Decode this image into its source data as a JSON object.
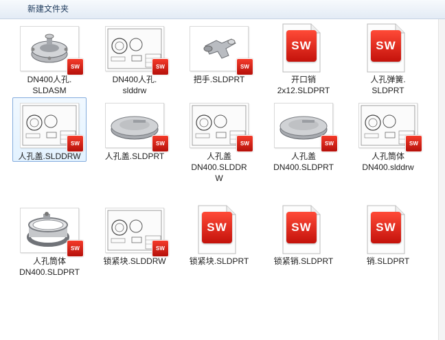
{
  "toolbar": {
    "new_folder_label": "新建文件夹"
  },
  "badge_text": "SW",
  "colors": {
    "badge": "#e0231a",
    "selection": "#cce8ff",
    "toolbar": "#e3ebf5"
  },
  "files": [
    {
      "name": "DN400人孔.SLDASM",
      "line1": "DN400人孔.",
      "line2": "SLDASM",
      "line3": "",
      "icon": "assembly-thumbnail-icon"
    },
    {
      "name": "DN400人孔.slddrw",
      "line1": "DN400人孔.",
      "line2": "slddrw",
      "line3": "",
      "icon": "drawing-thumbnail-icon"
    },
    {
      "name": "把手.SLDPRT",
      "line1": "把手.SLDPRT",
      "line2": "",
      "line3": "",
      "icon": "handle-part-thumbnail-icon"
    },
    {
      "name": "开口销2x12.SLDPRT",
      "line1": "开口销",
      "line2": "2x12.SLDPRT",
      "line3": "",
      "icon": "solidworks-document-icon"
    },
    {
      "name": "人孔弹簧.SLDPRT",
      "line1": "人孔弹簧.",
      "line2": "SLDPRT",
      "line3": "",
      "icon": "solidworks-document-icon"
    },
    {
      "name": "人孔盖.SLDDRW",
      "line1": "人孔盖.SLDDRW",
      "line2": "",
      "line3": "",
      "icon": "drawing-thumbnail-icon"
    },
    {
      "name": "人孔盖.SLDPRT",
      "line1": "人孔盖.SLDPRT",
      "line2": "",
      "line3": "",
      "icon": "cover-part-thumbnail-icon"
    },
    {
      "name": "人孔盖DN400.SLDDRW",
      "line1": "人孔盖",
      "line2": "DN400.SLDDR",
      "line3": "W",
      "icon": "drawing-thumbnail-icon"
    },
    {
      "name": "人孔盖DN400.SLDPRT",
      "line1": "人孔盖",
      "line2": "DN400.SLDPRT",
      "line3": "",
      "icon": "cover-part-thumbnail-icon"
    },
    {
      "name": "人孔筒体DN400.slddrw",
      "line1": "人孔筒体",
      "line2": "DN400.slddrw",
      "line3": "",
      "icon": "drawing-thumbnail-icon"
    },
    {
      "name": "人孔筒体DN400.SLDPRT",
      "line1": "人孔筒体",
      "line2": "DN400.SLDPRT",
      "line3": "",
      "icon": "cylinder-part-thumbnail-icon"
    },
    {
      "name": "锁紧块.SLDDRW",
      "line1": "锁紧块.SLDDRW",
      "line2": "",
      "line3": "",
      "icon": "drawing-thumbnail-icon"
    },
    {
      "name": "锁紧块.SLDPRT",
      "line1": "锁紧块.SLDPRT",
      "line2": "",
      "line3": "",
      "icon": "solidworks-document-icon"
    },
    {
      "name": "锁紧销.SLDPRT",
      "line1": "锁紧销.SLDPRT",
      "line2": "",
      "line3": "",
      "icon": "solidworks-document-icon"
    },
    {
      "name": "销.SLDPRT",
      "line1": "销.SLDPRT",
      "line2": "",
      "line3": "",
      "icon": "solidworks-document-icon"
    }
  ],
  "selected_index": 5
}
